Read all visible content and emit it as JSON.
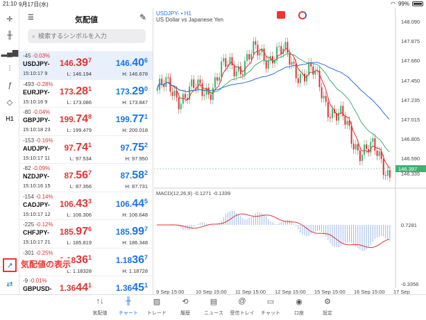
{
  "status": {
    "time": "21:10",
    "date": "9月17日(水)",
    "battery": "99%"
  },
  "quotes": {
    "title": "気配値",
    "search_placeholder": "検索するシンボルを入力",
    "overlay_label": "気配値の表示",
    "rows": [
      {
        "change": "-45",
        "pct": "-0.03%",
        "symbol": "USDJPY-",
        "time": "15:10:17",
        "spread": "9",
        "bid_main": "146.",
        "bid_big": "39",
        "bid_sup": "7",
        "ask_main": "146.",
        "ask_big": "40",
        "ask_sup": "6",
        "low": "L: 146.194",
        "high": "H: 146.678"
      },
      {
        "change": "-493",
        "pct": "-0.28%",
        "symbol": "EURJPY-",
        "time": "15:10:16",
        "spread": "9",
        "bid_main": "173.",
        "bid_big": "28",
        "bid_sup": "1",
        "ask_main": "173.",
        "ask_big": "29",
        "ask_sup": "0",
        "low": "L: 173.086",
        "high": "H: 173.847"
      },
      {
        "change": "-80",
        "pct": "-0.04%",
        "symbol": "GBPJPY-",
        "time": "15:10:18",
        "spread": "23",
        "bid_main": "199.",
        "bid_big": "74",
        "bid_sup": "8",
        "ask_main": "199.",
        "ask_big": "77",
        "ask_sup": "1",
        "low": "L: 199.479",
        "high": "H: 200.018"
      },
      {
        "change": "-153",
        "pct": "-0.16%",
        "symbol": "AUDJPY-",
        "time": "15:10:17",
        "spread": "11",
        "bid_main": "97.",
        "bid_big": "74",
        "bid_sup": "1",
        "ask_main": "97.",
        "ask_big": "75",
        "ask_sup": "2",
        "low": "L: 97.534",
        "high": "H: 97.950"
      },
      {
        "change": "-82",
        "pct": "-0.09%",
        "symbol": "NZDJPY-",
        "time": "15:10:16",
        "spread": "15",
        "bid_main": "87.",
        "bid_big": "56",
        "bid_sup": "7",
        "ask_main": "87.",
        "ask_big": "58",
        "ask_sup": "2",
        "low": "L: 87.356",
        "high": "H: 87.731"
      },
      {
        "change": "-154",
        "pct": "-0.14%",
        "symbol": "CADJPY-",
        "time": "15:10:17",
        "spread": "12",
        "bid_main": "106.",
        "bid_big": "43",
        "bid_sup": "3",
        "ask_main": "106.",
        "ask_big": "44",
        "ask_sup": "5",
        "low": "L: 106.306",
        "high": "H: 106.648"
      },
      {
        "change": "-225",
        "pct": "-0.12%",
        "symbol": "CHFJPY-",
        "time": "15:10:17",
        "spread": "21",
        "bid_main": "185.",
        "bid_big": "97",
        "bid_sup": "6",
        "ask_main": "185.",
        "ask_big": "99",
        "ask_sup": "7",
        "low": "L: 185.819",
        "high": "H: 186.348"
      },
      {
        "change": "-301",
        "pct": "-0.25%",
        "symbol": "",
        "time": "",
        "spread": "",
        "bid_main": "1.18",
        "bid_big": "36",
        "bid_sup": "1",
        "ask_main": "1.18",
        "ask_big": "36",
        "ask_sup": "7",
        "low": "L: 1.18328",
        "high": "H: 1.18728"
      },
      {
        "change": "-9",
        "pct": "-0.01%",
        "symbol": "GBPUSD-",
        "time": "",
        "spread": "",
        "bid_main": "1.36",
        "bid_big": "44",
        "bid_sup": "1",
        "ask_main": "1.36",
        "ask_big": "45",
        "ask_sup": "1",
        "low": "",
        "high": ""
      }
    ]
  },
  "chart": {
    "symbol_line": "USDJPY- • H1",
    "description": "US Dollar vs Japanese Yen",
    "macd_label": "MACD(12,26,9) -0.1271 -0.1339",
    "current_price": "146.397",
    "price_ticks": [
      "148.090",
      "147.875",
      "147.660",
      "147.450",
      "147.235",
      "147.015",
      "146.805",
      "146.590",
      "146.335"
    ],
    "macd_ticks": [
      "0.7281",
      "-0.3356"
    ],
    "time_ticks": [
      "9 Sep 15:00",
      "10 Sep 15:00",
      "11 Sep 15:00",
      "12 Sep 15:00",
      "15 Sep 15:00",
      "16 Sep 15:00",
      "17 Sep"
    ],
    "colors": {
      "price_line": "#1a73e8",
      "ma_fast": "#e03333",
      "ma_mid": "#3cb371",
      "ma_slow": "#2e6bd8",
      "candle_up": "#3cb371",
      "candle_down": "#e03333",
      "macd_hist": "#9ab8e6",
      "macd_signal": "#e03333"
    }
  },
  "chart_data": {
    "type": "line",
    "title": "USDJPY- • H1",
    "x": [
      "9 Sep 15:00",
      "10 Sep 15:00",
      "11 Sep 15:00",
      "12 Sep 15:00",
      "15 Sep 15:00",
      "16 Sep 15:00",
      "17 Sep"
    ],
    "series": [
      {
        "name": "USDJPY-",
        "values": [
          147.3,
          147.25,
          147.6,
          147.75,
          147.45,
          146.75,
          146.397
        ]
      }
    ],
    "ylim": [
      146.2,
      148.2
    ]
  },
  "tabs": [
    {
      "label": "気配値",
      "icon": "quotes-icon"
    },
    {
      "label": "チャート",
      "icon": "chart-icon"
    },
    {
      "label": "トレード",
      "icon": "trade-icon"
    },
    {
      "label": "履歴",
      "icon": "history-icon"
    },
    {
      "label": "ニュース",
      "icon": "news-icon"
    },
    {
      "label": "受信トレイ",
      "icon": "mail-icon"
    },
    {
      "label": "チャット",
      "icon": "chat-icon"
    },
    {
      "label": "口座",
      "icon": "account-icon"
    },
    {
      "label": "設定",
      "icon": "settings-icon"
    }
  ]
}
